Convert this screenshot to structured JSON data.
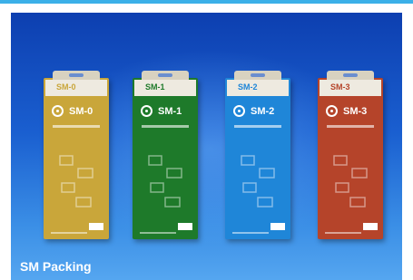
{
  "caption": "SM Packing",
  "packs": [
    {
      "head": "SM-0",
      "label": "SM-0",
      "color": "#c9a63a"
    },
    {
      "head": "SM-1",
      "label": "SM-1",
      "color": "#1e7a2a"
    },
    {
      "head": "SM-2",
      "label": "SM-2",
      "color": "#1f86d8"
    },
    {
      "head": "SM-3",
      "label": "SM-3",
      "color": "#b5442a"
    }
  ]
}
